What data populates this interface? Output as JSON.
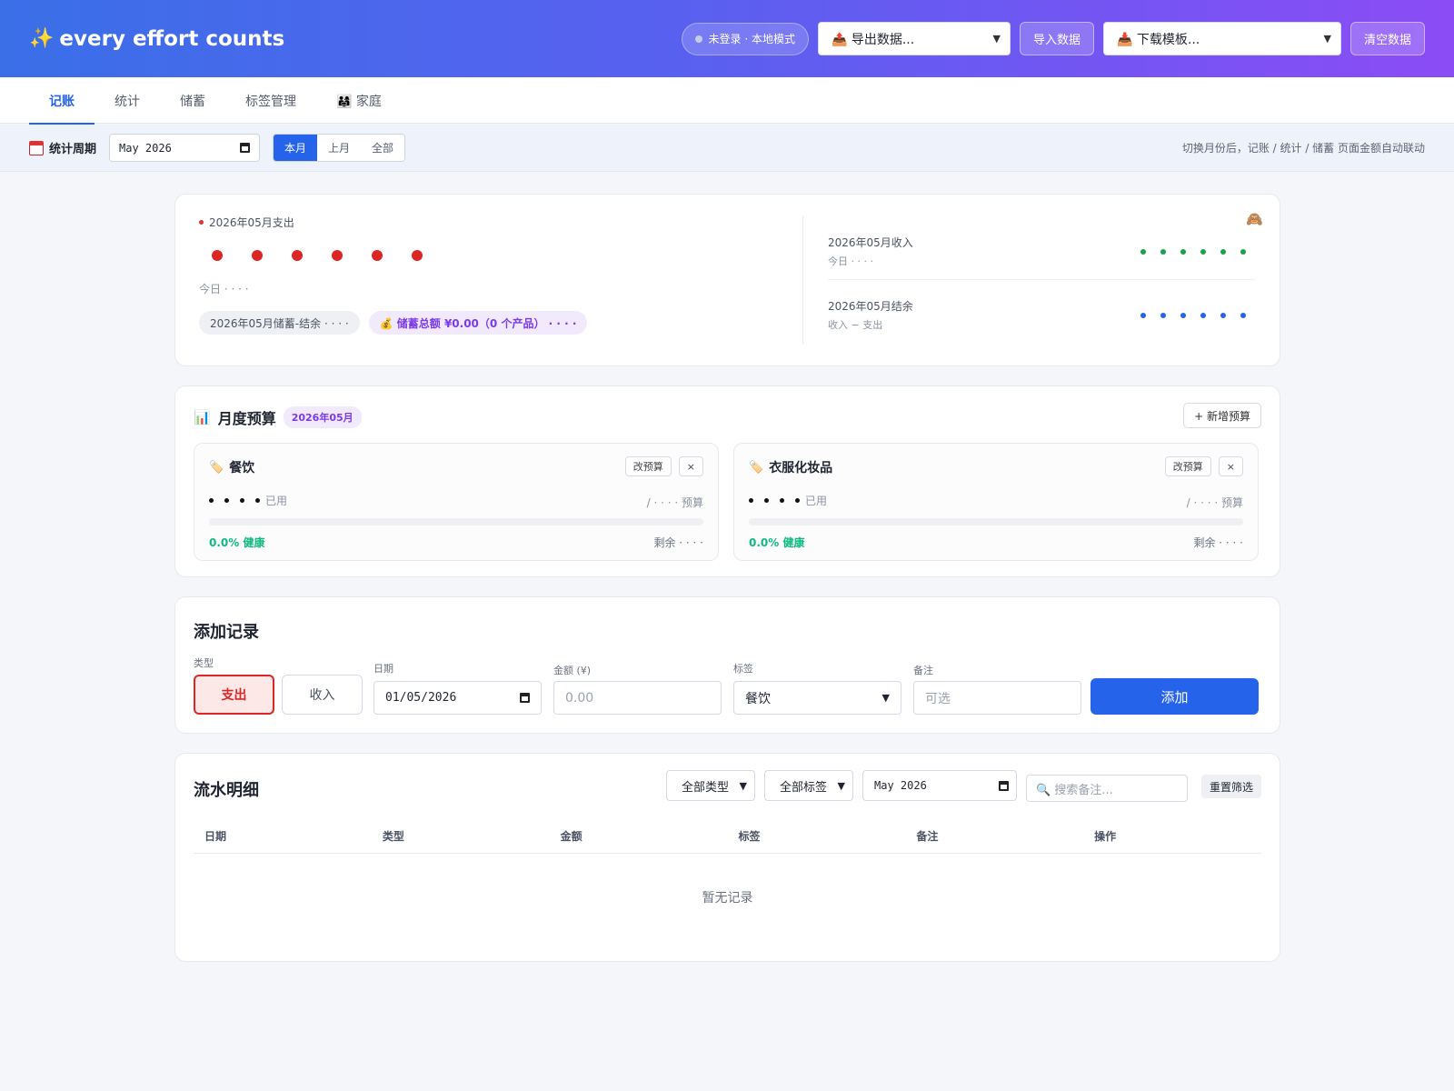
{
  "header": {
    "brand_icon": "✨",
    "brand": "every effort counts",
    "status": "未登录 · 本地模式",
    "export_select": "📤 导出数据...",
    "import_label": "导入数据",
    "template_select": "📥 下载模板...",
    "clear_label": "清空数据"
  },
  "tabs": [
    "记账",
    "统计",
    "储蓄",
    "标签管理",
    "👨‍👩‍👧 家庭"
  ],
  "active_tab": "记账",
  "period": {
    "label": "统计周期",
    "month_value": "May 2026",
    "buttons": [
      "本月",
      "上月",
      "全部"
    ],
    "active_button": "本月",
    "note": "切换月份后，记账 / 统计 / 储蓄 页面金额自动联动"
  },
  "summary": {
    "expense_title": "2026年05月支出",
    "today_label": "今日 · · · ·",
    "chip_balance": "2026年05月储蓄-结余 · · · ·",
    "chip_savings": "💰 储蓄总额 ¥0.00（0 个产品） · · · ·",
    "income_title": "2026年05月收入",
    "income_sub": "今日 · · · ·",
    "balance_title": "2026年05月结余",
    "balance_sub": "收入 − 支出",
    "colors": {
      "expense": "#dc2626",
      "income": "#16a34a",
      "balance": "#2563eb"
    }
  },
  "budget": {
    "title": "月度预算",
    "month_tag": "2026年05月",
    "add_label": "+ 新增预算",
    "items": [
      {
        "name": "餐饮",
        "edit_label": "改预算",
        "delete_label": "×",
        "used_label": "已用",
        "limit_label": "/ · · · · 预算",
        "progress": 0.0,
        "status": "0.0% 健康",
        "remain": "剩余 · · · ·"
      },
      {
        "name": "衣服化妆品",
        "edit_label": "改预算",
        "delete_label": "×",
        "used_label": "已用",
        "limit_label": "/ · · · · 预算",
        "progress": 0.0,
        "status": "0.0% 健康",
        "remain": "剩余 · · · ·"
      }
    ]
  },
  "add_record": {
    "title": "添加记录",
    "type_label": "类型",
    "type_expense": "支出",
    "type_income": "收入",
    "date_label": "日期",
    "date_value": "01/05/2026",
    "amount_label": "金额 (¥)",
    "amount_placeholder": "0.00",
    "tag_label": "标签",
    "tag_value": "餐饮",
    "note_label": "备注",
    "note_placeholder": "可选",
    "submit_label": "添加"
  },
  "ledger": {
    "title": "流水明细",
    "type_filter": "全部类型",
    "tag_filter": "全部标签",
    "month_filter": "May 2026",
    "search_placeholder": "🔍 搜索备注...",
    "reset_label": "重置筛选",
    "columns": [
      "日期",
      "类型",
      "金额",
      "标签",
      "备注",
      "操作"
    ],
    "empty": "暂无记录"
  }
}
